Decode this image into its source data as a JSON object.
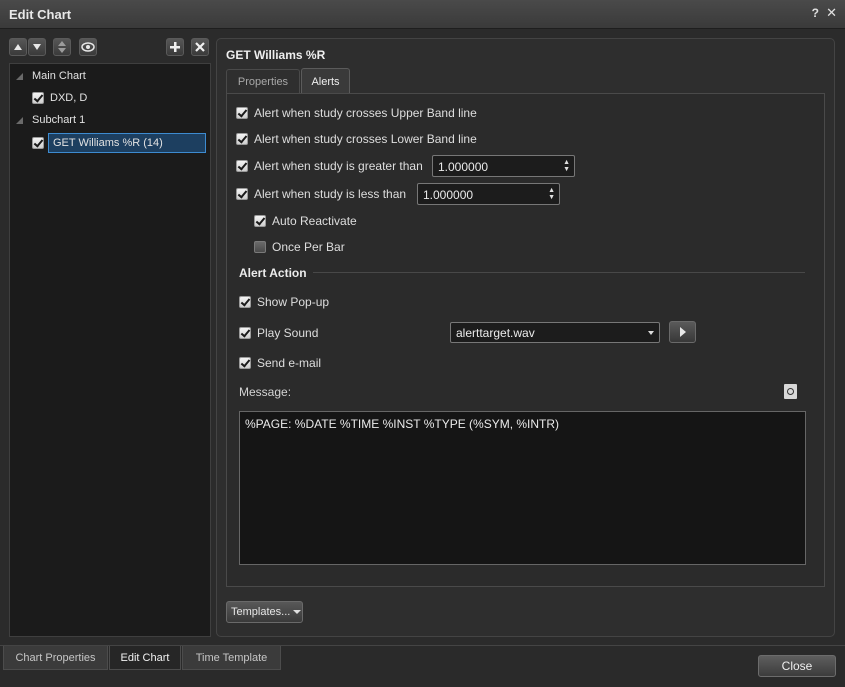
{
  "window": {
    "title": "Edit Chart",
    "help_label": "?",
    "close_label": "✕"
  },
  "tree": {
    "nodes": [
      {
        "label": "Main Chart",
        "type": "group"
      },
      {
        "label": "DXD, D",
        "type": "item",
        "checked": true
      },
      {
        "label": "Subchart 1",
        "type": "group"
      },
      {
        "label": "GET Williams %R (14)",
        "type": "item",
        "checked": true,
        "selected": true
      }
    ]
  },
  "study": {
    "title": "GET Williams %R"
  },
  "tabs": [
    {
      "label": "Properties",
      "active": false
    },
    {
      "label": "Alerts",
      "active": true
    }
  ],
  "alerts": {
    "upper_band": {
      "label": "Alert when study crosses Upper Band line",
      "checked": true
    },
    "lower_band": {
      "label": "Alert when study crosses Lower Band line",
      "checked": true
    },
    "greater_than": {
      "label": "Alert when study is greater than",
      "checked": true,
      "value": "1.000000"
    },
    "less_than": {
      "label": "Alert when study is less than",
      "checked": true,
      "value": "1.000000"
    },
    "auto_reactivate": {
      "label": "Auto Reactivate",
      "checked": true
    },
    "once_per_bar": {
      "label": "Once Per Bar",
      "checked": false
    }
  },
  "alert_action": {
    "title": "Alert Action",
    "show_popup": {
      "label": "Show Pop-up",
      "checked": true
    },
    "play_sound": {
      "label": "Play Sound",
      "checked": true,
      "sound_file": "alerttarget.wav"
    },
    "send_email": {
      "label": "Send e-mail",
      "checked": true
    }
  },
  "message": {
    "label": "Message:",
    "text": "%PAGE: %DATE %TIME %INST %TYPE (%SYM, %INTR)"
  },
  "templates_button": "Templates...",
  "bottom_tabs": [
    {
      "label": "Chart Properties",
      "active": false
    },
    {
      "label": "Edit Chart",
      "active": true
    },
    {
      "label": "Time Template",
      "active": false
    }
  ],
  "close_button": "Close",
  "colors": {
    "selection_border": "#3d8bd0",
    "selection_bg": "#1d3f60",
    "panel_bg": "#2b2b2b"
  }
}
